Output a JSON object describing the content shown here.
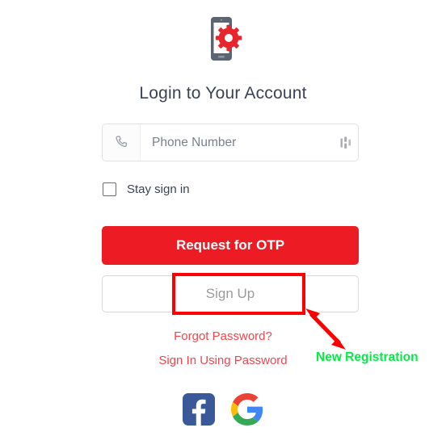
{
  "branding": {
    "logo_icon": "phone-gear-icon",
    "phone_body_color": "#5A6472",
    "phone_screen_color": "#FFFFFF",
    "gear_color": "#E8252C"
  },
  "header": {
    "title": "Login to Your Account"
  },
  "form": {
    "phone_field": {
      "icon": "phone-handset-icon",
      "placeholder": "Phone Number",
      "value": "",
      "suffix_icon": "dialpad-icon"
    },
    "stay_signed_in": {
      "label": "Stay sign in",
      "checked": false,
      "icon": "checkbox-unchecked-icon"
    },
    "request_otp_button": {
      "label": "Request for OTP",
      "color": "#ED1C24",
      "text_color": "#FFFFFF"
    },
    "sign_up_button": {
      "label": "Sign Up",
      "text_color": "#9A9A9A",
      "border_color": "#D9D9DD"
    }
  },
  "links": {
    "forgot_password": "Forgot Password?",
    "sign_in_using_password": "Sign In Using Password",
    "link_color": "#F0464E"
  },
  "social": {
    "facebook": {
      "name": "facebook-icon",
      "color": "#3B5998"
    },
    "google": {
      "name": "google-icon",
      "colors": [
        "#EA4335",
        "#FBBC05",
        "#34A853",
        "#4285F4"
      ]
    }
  },
  "annotations": {
    "highlight_box": {
      "target": "sign-up-button",
      "color": "#FE0000"
    },
    "arrow": {
      "color": "#FE0000",
      "style": "double-headed"
    },
    "callout_text": "New Registration",
    "callout_color": "#00EE44"
  }
}
